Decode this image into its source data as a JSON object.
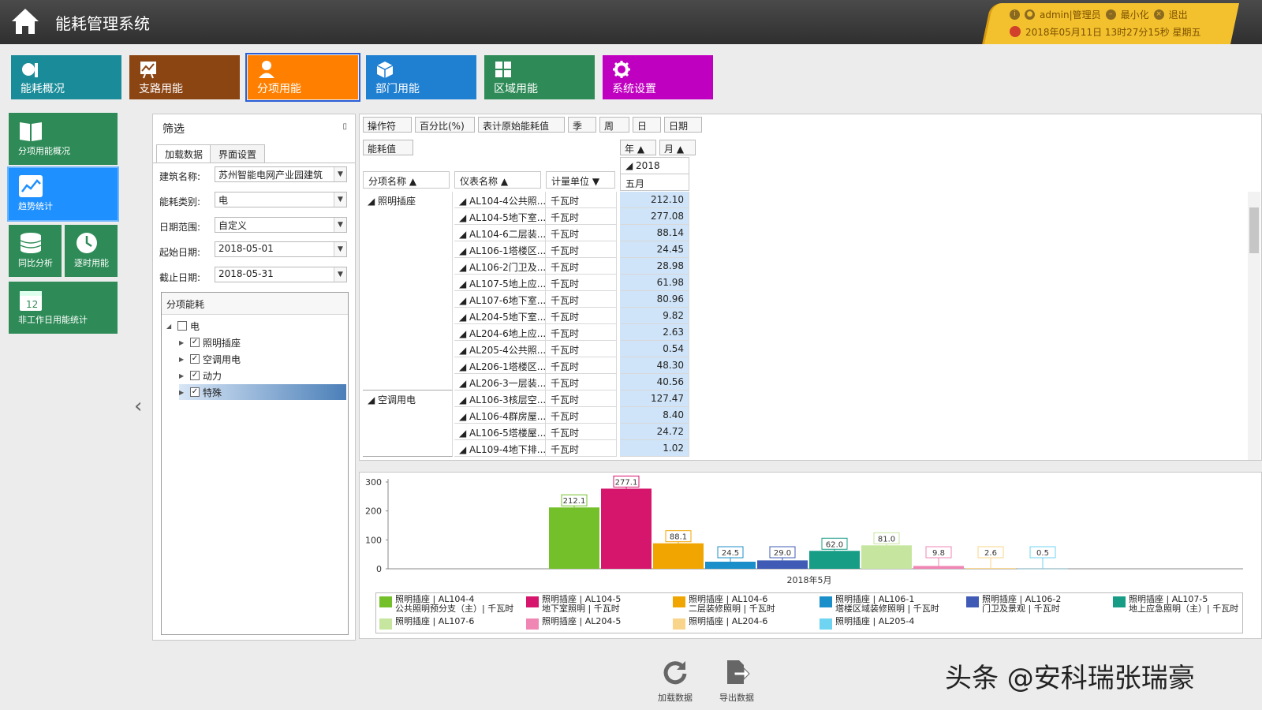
{
  "header": {
    "title": "能耗管理系统",
    "user": "admin|管理员",
    "minimize": "最小化",
    "logout": "退出",
    "datetime": "2018年05月11日 13时27分15秒 星期五"
  },
  "top_nav": [
    {
      "label": "能耗概况",
      "color": "#1a8c99",
      "icon": "gauge-icon"
    },
    {
      "label": "支路用能",
      "color": "#8b4513",
      "icon": "chart-board-icon"
    },
    {
      "label": "分项用能",
      "color": "#ff8000",
      "icon": "user-icon"
    },
    {
      "label": "部门用能",
      "color": "#1f7fd1",
      "icon": "cube-icon"
    },
    {
      "label": "区域用能",
      "color": "#2e8b57",
      "icon": "grid-icon"
    },
    {
      "label": "系统设置",
      "color": "#c000c0",
      "icon": "gear-icon"
    }
  ],
  "side_nav": [
    {
      "label": "分项用能概况",
      "icon": "book-icon"
    },
    {
      "label": "趋势统计",
      "icon": "trend-icon"
    },
    {
      "label": "同比分析",
      "icon": "database-icon"
    },
    {
      "label": "逐时用能",
      "icon": "clock-icon"
    },
    {
      "label": "非工作日用能统计",
      "icon": "calendar-icon",
      "badge": "12"
    }
  ],
  "filter": {
    "title": "筛选",
    "tabs": [
      "加载数据",
      "界面设置"
    ],
    "fields": [
      {
        "label": "建筑名称:",
        "value": "苏州智能电网产业园建筑"
      },
      {
        "label": "能耗类别:",
        "value": "电"
      },
      {
        "label": "日期范围:",
        "value": "自定义"
      },
      {
        "label": "起始日期:",
        "value": "2018-05-01"
      },
      {
        "label": "截止日期:",
        "value": "2018-05-31"
      }
    ],
    "tree_title": "分项能耗",
    "tree_root": "电",
    "tree_items": [
      "照明插座",
      "空调用电",
      "动力",
      "特殊"
    ]
  },
  "grid": {
    "toolbar": [
      "操作符",
      "百分比(%)",
      "表计原始能耗值",
      "季",
      "周",
      "日",
      "日期"
    ],
    "data_field": "能耗值",
    "year_btn": "年",
    "month_btn": "月",
    "col_headers": [
      "分项名称",
      "仪表名称",
      "计量单位"
    ],
    "year": "2018",
    "month": "五月",
    "groups": [
      {
        "name": "照明插座",
        "rows": [
          {
            "meter": "AL104-4公共照...",
            "unit": "千瓦时",
            "value": "212.10"
          },
          {
            "meter": "AL104-5地下室...",
            "unit": "千瓦时",
            "value": "277.08"
          },
          {
            "meter": "AL104-6二层装...",
            "unit": "千瓦时",
            "value": "88.14"
          },
          {
            "meter": "AL106-1塔楼区...",
            "unit": "千瓦时",
            "value": "24.45"
          },
          {
            "meter": "AL106-2门卫及...",
            "unit": "千瓦时",
            "value": "28.98"
          },
          {
            "meter": "AL107-5地上应...",
            "unit": "千瓦时",
            "value": "61.98"
          },
          {
            "meter": "AL107-6地下室...",
            "unit": "千瓦时",
            "value": "80.96"
          },
          {
            "meter": "AL204-5地下室...",
            "unit": "千瓦时",
            "value": "9.82"
          },
          {
            "meter": "AL204-6地上应...",
            "unit": "千瓦时",
            "value": "2.63"
          },
          {
            "meter": "AL205-4公共照...",
            "unit": "千瓦时",
            "value": "0.54"
          },
          {
            "meter": "AL206-1塔楼区...",
            "unit": "千瓦时",
            "value": "48.30"
          },
          {
            "meter": "AL206-3一层装...",
            "unit": "千瓦时",
            "value": "40.56"
          }
        ]
      },
      {
        "name": "空调用电",
        "rows": [
          {
            "meter": "AL106-3核层空...",
            "unit": "千瓦时",
            "value": "127.47"
          },
          {
            "meter": "AL106-4群房屋...",
            "unit": "千瓦时",
            "value": "8.40"
          },
          {
            "meter": "AL106-5塔楼屋...",
            "unit": "千瓦时",
            "value": "24.72"
          },
          {
            "meter": "AL109-4地下排...",
            "unit": "千瓦时",
            "value": "1.02"
          }
        ]
      }
    ]
  },
  "chart_data": {
    "type": "bar",
    "categories": [
      "2018年5月"
    ],
    "ylim": [
      0,
      300
    ],
    "yticks": [
      0,
      100,
      200,
      300
    ],
    "series": [
      {
        "name": "照明插座 | AL104-4 公共照明预分支（主）| 千瓦时",
        "value": 212.1,
        "label": "212.1",
        "color": "#73c02a"
      },
      {
        "name": "照明插座 | AL104-5 地下室照明 | 千瓦时",
        "value": 277.1,
        "label": "277.1",
        "color": "#d6156c"
      },
      {
        "name": "照明插座 | AL104-6 二层装修照明 | 千瓦时",
        "value": 88.1,
        "label": "88.1",
        "color": "#f0a500"
      },
      {
        "name": "照明插座 | AL106-1 塔楼区域装修照明 | 千瓦时",
        "value": 24.5,
        "label": "24.5",
        "color": "#1b8fc9"
      },
      {
        "name": "照明插座 | AL106-2 门卫及景观 | 千瓦时",
        "value": 29.0,
        "label": "29.0",
        "color": "#3f5bb5"
      },
      {
        "name": "照明插座 | AL107-5 地上应急照明（主）| 千瓦时",
        "value": 62.0,
        "label": "62.0",
        "color": "#179c86"
      },
      {
        "name": "照明插座 | AL107-6",
        "value": 81.0,
        "label": "81.0",
        "color": "#c6e6a0"
      },
      {
        "name": "照明插座 | AL204-5",
        "value": 9.8,
        "label": "9.8",
        "color": "#ef86b4"
      },
      {
        "name": "照明插座 | AL204-6",
        "value": 2.6,
        "label": "2.6",
        "color": "#f8d58a"
      },
      {
        "name": "照明插座 | AL205-4",
        "value": 0.5,
        "label": "0.5",
        "color": "#6fd4f2"
      }
    ],
    "legend": [
      {
        "l1": "照明插座 | AL104-4",
        "l2": "公共照明预分支（主）| 千瓦时",
        "color": "#73c02a"
      },
      {
        "l1": "照明插座 | AL104-5",
        "l2": "地下室照明 | 千瓦时",
        "color": "#d6156c"
      },
      {
        "l1": "照明插座 | AL104-6",
        "l2": "二层装修照明 | 千瓦时",
        "color": "#f0a500"
      },
      {
        "l1": "照明插座 | AL106-1",
        "l2": "塔楼区域装修照明 | 千瓦时",
        "color": "#1b8fc9"
      },
      {
        "l1": "照明插座 | AL106-2",
        "l2": "门卫及景观 | 千瓦时",
        "color": "#3f5bb5"
      },
      {
        "l1": "照明插座 | AL107-5",
        "l2": "地上应急照明（主）| 千瓦时",
        "color": "#179c86"
      },
      {
        "l1": "照明插座 | AL107-6",
        "l2": "",
        "color": "#c6e6a0"
      },
      {
        "l1": "照明插座 | AL204-5",
        "l2": "",
        "color": "#ef86b4"
      },
      {
        "l1": "照明插座 | AL204-6",
        "l2": "",
        "color": "#f8d58a"
      },
      {
        "l1": "照明插座 | AL205-4",
        "l2": "",
        "color": "#6fd4f2"
      }
    ]
  },
  "bottom_buttons": [
    {
      "label": "加载数据",
      "icon": "refresh-icon"
    },
    {
      "label": "导出数据",
      "icon": "export-icon"
    }
  ],
  "watermark": "头条 @安科瑞张瑞豪"
}
